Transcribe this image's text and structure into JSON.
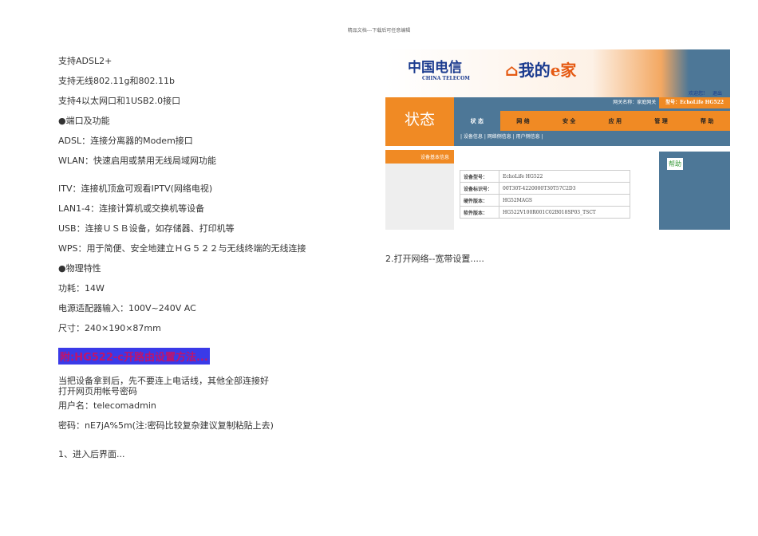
{
  "header": "精品文档---下载后可任意编辑",
  "left_lines": [
    "支持ADSL2+",
    "支持无线802.11g和802.11b",
    "支持4以太网口和1USB2.0接口",
    "●端口及功能",
    "ADSL：连接分离器的Modem接口",
    "WLAN：快速启用或禁用无线局域网功能",
    "ITV：连接机顶盒可观看IPTV(网络电视)",
    "LAN1-4：连接计算机或交换机等设备",
    "USB：连接ＵＳＢ设备，如存储器、打印机等",
    "WPS：用于简便、安全地建立ＨＧ５２２与无线终端的无线连接",
    "●物理特性",
    "功耗：14W",
    "电源适配器输入：100V~240V AC",
    "尺寸：240×190×87mm"
  ],
  "section_heading": "附:HG522-c开路由设置方法...",
  "body_lines": [
    "当把设备拿到后，先不要连上电话线，其他全部连接好",
    "打开网页用帐号密码",
    "用户名：telecomadmin",
    "密码：nE7jA%5m(注:密码比较复杂建议复制粘贴上去)",
    "1、进入后界面..."
  ],
  "screenshot": {
    "logo_telecom": "中国电信",
    "logo_telecom_en": "CHINA TELECOM",
    "logo_home": "我的",
    "logo_home_e": "e家",
    "welcome": "欢迎您!",
    "logout": "退出",
    "gateway_name": "网关名称：家庭网关",
    "model": "型号：EchoLife HG522",
    "section": "状态",
    "tabs": [
      "状 态",
      "网 络",
      "安 全",
      "应 用",
      "管 理",
      "帮 助"
    ],
    "subnav": "| 设备信息 | 网络侧信息 | 用户侧信息 |",
    "side_item": "设备基本信息",
    "rows": [
      [
        "设备型号：",
        "EchoLife HG522"
      ],
      [
        "设备标识号：",
        "00T30T-4220000T30T57C2D3"
      ],
      [
        "硬件版本：",
        "HG52MAGS"
      ],
      [
        "软件版本：",
        "HG522V100R001C02B018SP03_TSCT"
      ]
    ],
    "help": "帮助"
  },
  "right_caption": "2.打开网络--宽带设置....."
}
